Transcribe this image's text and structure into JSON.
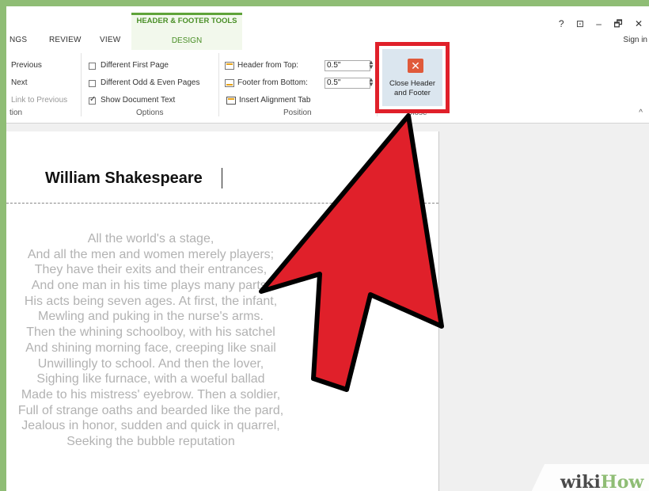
{
  "tabs": {
    "left_partial": "NGS",
    "review": "REVIEW",
    "view": "VIEW",
    "context_group": "HEADER & FOOTER TOOLS",
    "design": "DESIGN"
  },
  "window": {
    "help": "?",
    "ribbon_display": "⊡",
    "minimize": "–",
    "restore": "🗗",
    "close": "✕",
    "sign_in": "Sign in"
  },
  "ribbon": {
    "navigation": {
      "previous": "Previous",
      "next": "Next",
      "link_to_previous": "Link to Previous",
      "group_label": "tion"
    },
    "options": {
      "different_first_page": "Different First Page",
      "different_odd_even": "Different Odd & Even Pages",
      "show_document_text": "Show Document Text",
      "different_first_page_checked": false,
      "different_odd_even_checked": false,
      "show_document_text_checked": true,
      "group_label": "Options"
    },
    "position": {
      "header_from_top_label": "Header from Top:",
      "header_from_top_value": "0.5\"",
      "footer_from_bottom_label": "Footer from Bottom:",
      "footer_from_bottom_value": "0.5\"",
      "insert_alignment_tab": "Insert Alignment Tab",
      "group_label": "Position"
    },
    "close": {
      "label_line1": "Close Header",
      "label_line2": "and Footer",
      "group_label": "Close",
      "icon": "close-x-icon"
    },
    "collapse": "^"
  },
  "document": {
    "header_text": "William Shakespeare",
    "body_lines": [
      "All the world's a stage,",
      "And all the men and women merely players;",
      "They have their exits and their entrances,",
      "And one man in his time plays many parts,",
      "His acts being seven ages. At first, the infant,",
      "Mewling and puking in the nurse's arms.",
      "Then the whining schoolboy, with his satchel",
      "And shining morning face, creeping like snail",
      "Unwillingly to school. And then the lover,",
      "Sighing like furnace, with a woeful ballad",
      "Made to his mistress' eyebrow. Then a soldier,",
      "Full of strange oaths and bearded like the pard,",
      "Jealous in honor, sudden and quick in quarrel,",
      "Seeking the bubble reputation"
    ]
  },
  "annotation": {
    "arrow_color": "#e0202a",
    "highlight_color": "#e0202a"
  },
  "watermark": {
    "part1": "wiki",
    "part2": "How"
  }
}
